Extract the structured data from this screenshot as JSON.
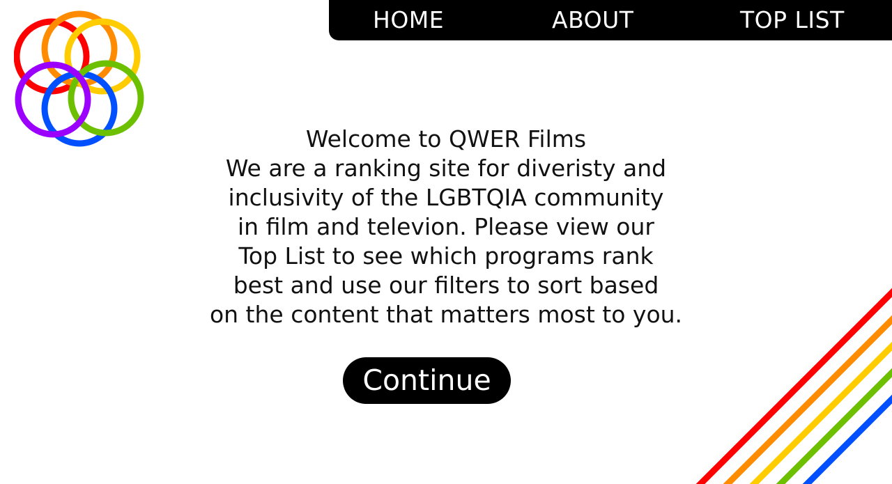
{
  "logo": {
    "name": "rainbow-rings-logo",
    "ring_colors": [
      "#ff0000",
      "#ff8c00",
      "#ffcc00",
      "#9b00ff",
      "#0050ff",
      "#6cc000"
    ]
  },
  "nav": {
    "items": [
      {
        "label": "HOME"
      },
      {
        "label": "ABOUT"
      },
      {
        "label": "TOP LIST"
      }
    ]
  },
  "intro": {
    "lines": [
      "Welcome to QWER Films",
      "We are a ranking site for diveristy and",
      "inclusivity of the LGBTQIA community",
      "in film and televion. Please view our",
      "Top List to see which programs rank",
      "best and use our filters to sort based",
      "on the content that matters most to you."
    ]
  },
  "continue": {
    "label": "Continue"
  },
  "decor": {
    "stripe_colors": [
      "#ff0000",
      "#ff8c00",
      "#ffcc00",
      "#6cc000",
      "#0050ff"
    ]
  }
}
